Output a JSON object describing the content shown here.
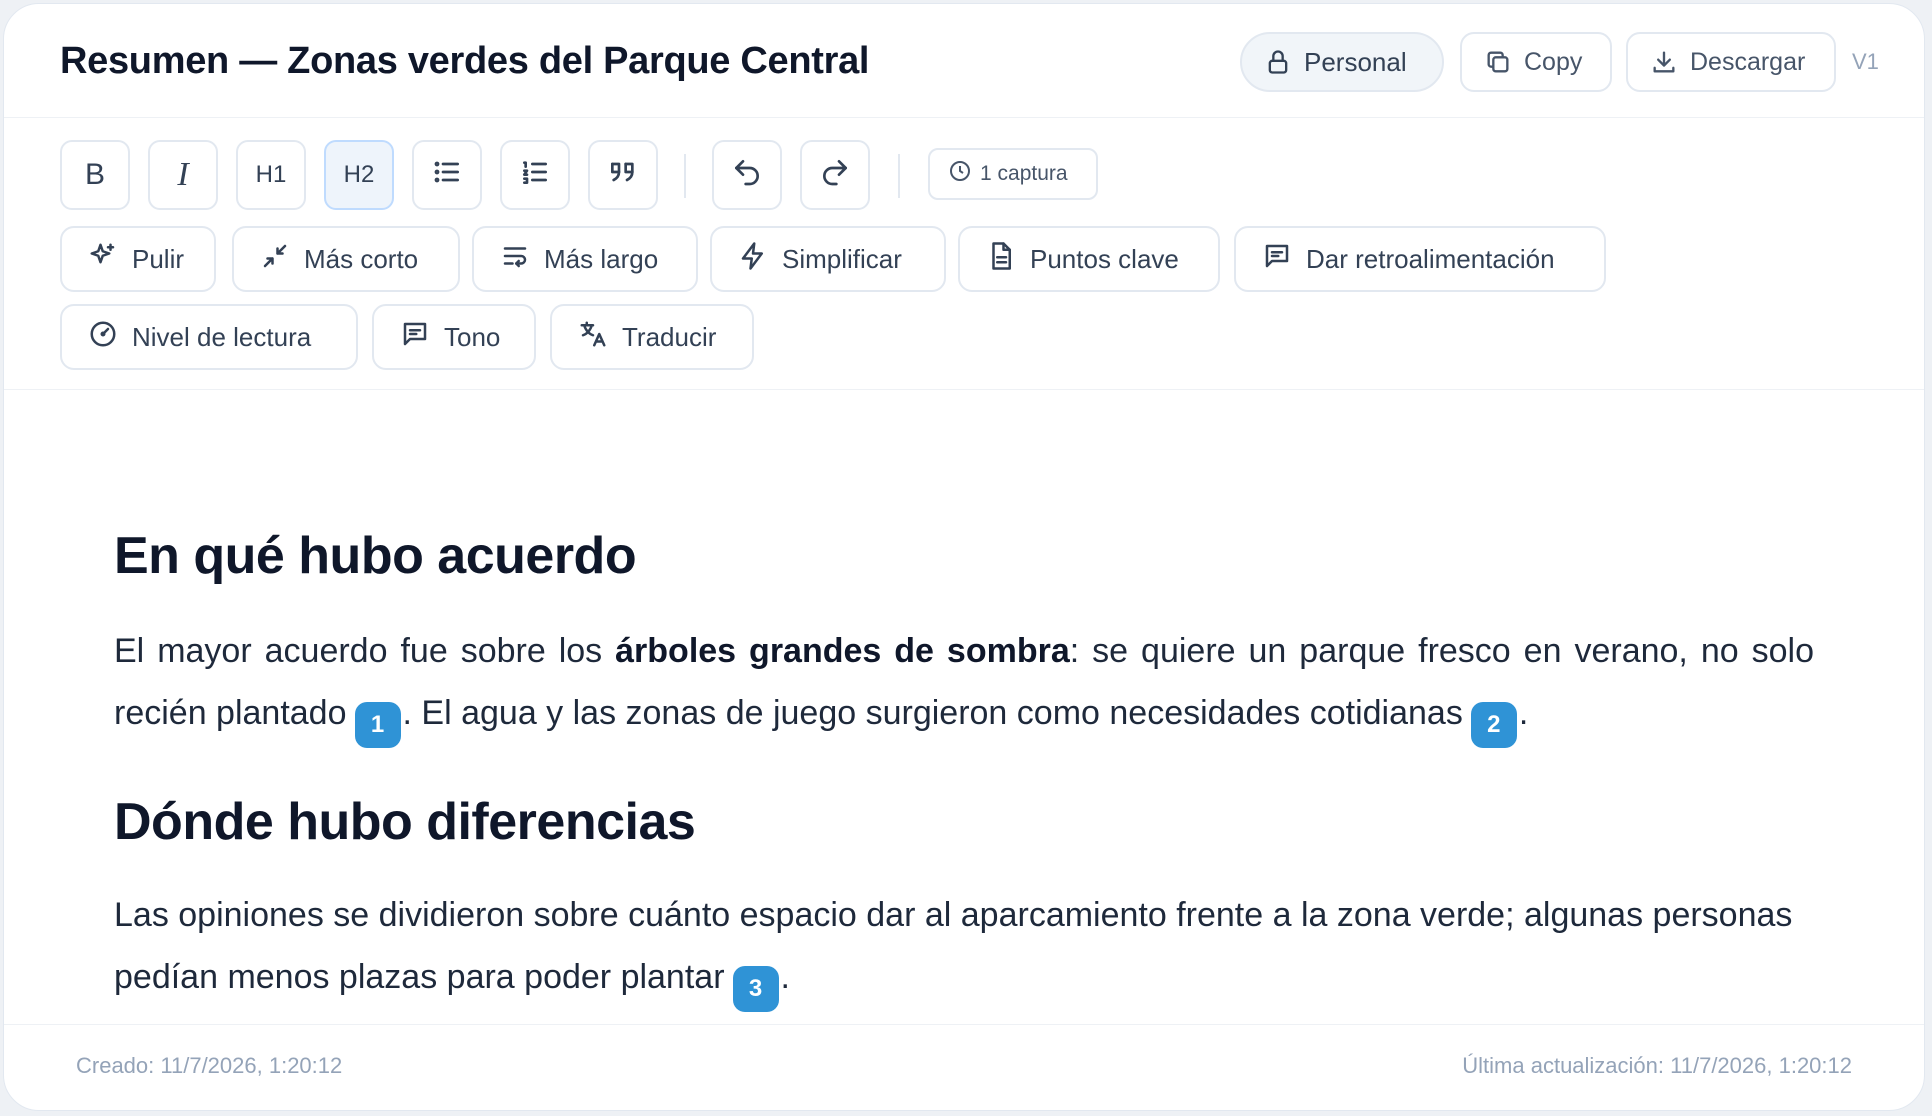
{
  "header": {
    "title": "Resumen — Zonas verdes del Parque Central",
    "visibility_label": "Personal",
    "copy_label": "Copy",
    "download_label": "Descargar",
    "version": "V1"
  },
  "toolbar": {
    "format_buttons": [
      {
        "name": "bold",
        "label": "B"
      },
      {
        "name": "italic",
        "label": "I"
      },
      {
        "name": "heading-1",
        "label": "H1"
      },
      {
        "name": "heading-2",
        "label": "H2",
        "active": true
      },
      {
        "name": "bulleted-list",
        "icon": "list-icon"
      },
      {
        "name": "numbered-list",
        "icon": "ordered-list-icon"
      },
      {
        "name": "quote",
        "icon": "quote-icon"
      },
      {
        "name": "undo",
        "icon": "undo-icon"
      },
      {
        "name": "redo",
        "icon": "redo-icon"
      }
    ],
    "history_label": "1 captura",
    "actions": [
      {
        "label": "Pulir",
        "icon": "sparkles-icon"
      },
      {
        "label": "Más corto",
        "icon": "shrink-icon"
      },
      {
        "label": "Más largo",
        "icon": "wrap-text-icon"
      },
      {
        "label": "Simplificar",
        "icon": "lightning-icon"
      },
      {
        "label": "Puntos clave",
        "icon": "document-icon"
      },
      {
        "label": "Dar retroalimentación",
        "icon": "message-icon"
      },
      {
        "label": "Nivel de lectura",
        "icon": "gauge-icon"
      },
      {
        "label": "Tono",
        "icon": "message-icon"
      },
      {
        "label": "Traducir",
        "icon": "translate-icon"
      }
    ]
  },
  "content": {
    "section1_heading": "En qué hubo acuerdo",
    "section1_p_a": "El mayor acuerdo fue sobre los ",
    "section1_p_bold": "árboles grandes de sombra",
    "section1_p_b": ": se quiere un parque fresco en verano, no solo recién plantado",
    "section1_p_c": ". El agua y las zonas de juego surgieron como necesidades cotidianas",
    "section1_p_d": ".",
    "section2_heading": "Dónde hubo diferencias",
    "section2_p_a": "Las opiniones se dividieron sobre cuánto espacio dar al aparcamiento frente a la zona verde; algunas personas pedían menos plazas para poder plantar",
    "section2_p_b": ".",
    "citations": [
      "1",
      "2",
      "3"
    ],
    "citation_color": "#2f93d6"
  },
  "footer": {
    "created": "Creado: 11/7/2026, 1:20:12",
    "updated": "Última actualización: 11/7/2026, 1:20:12"
  }
}
